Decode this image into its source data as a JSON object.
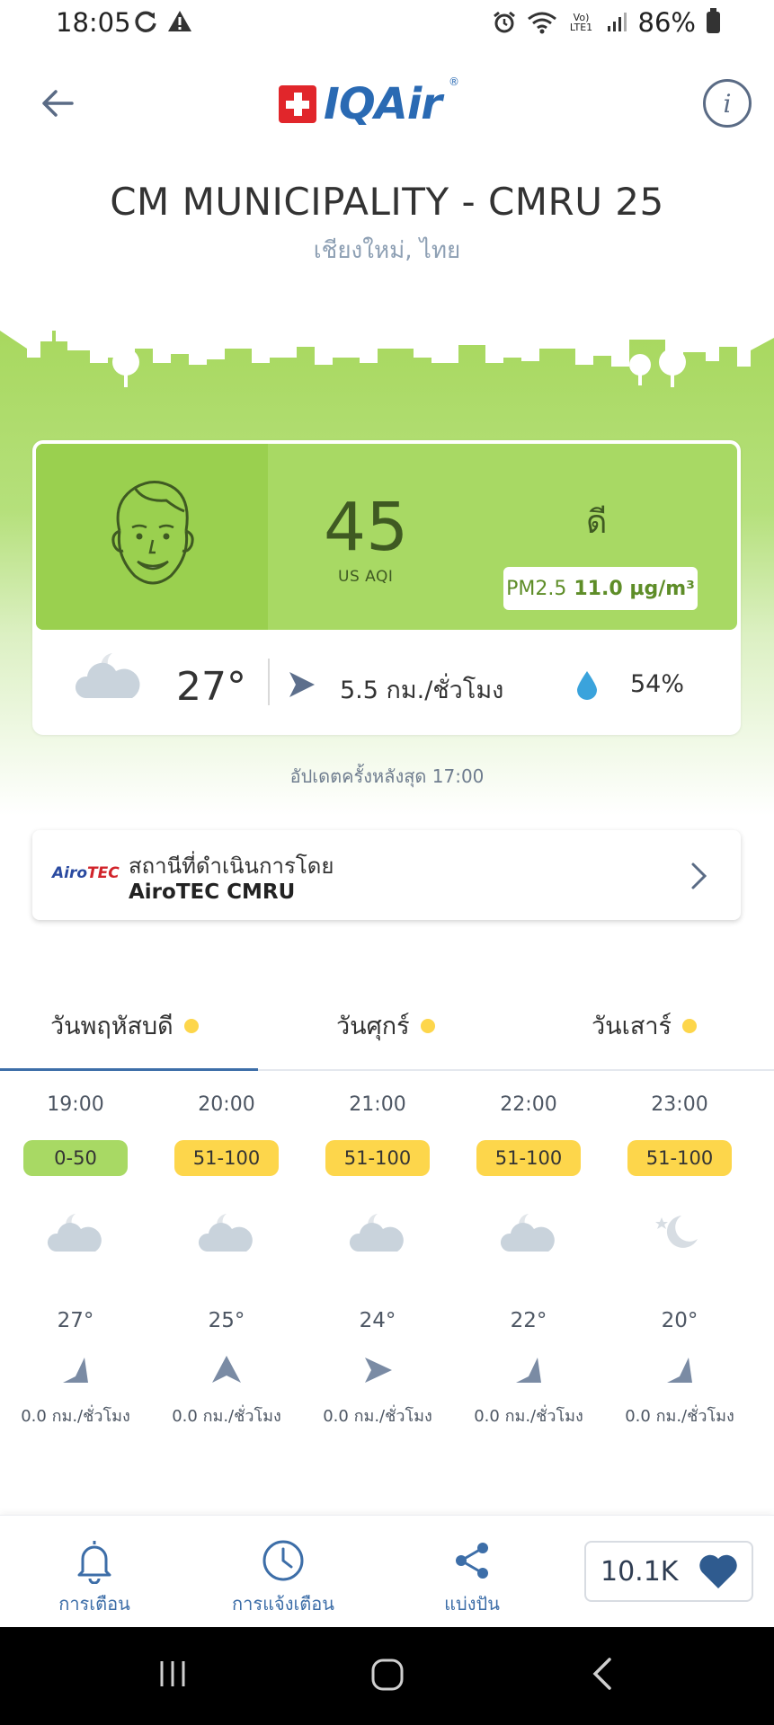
{
  "status_bar": {
    "time": "18:05",
    "battery": "86%",
    "network_label": "Vo) LTE1"
  },
  "header": {
    "logo_text": "IQAir",
    "logo_mark": "®"
  },
  "station": {
    "title": "CM MUNICIPALITY - CMRU 25",
    "location": "เชียงใหม่, ไทย"
  },
  "aqi": {
    "value": "45",
    "unit": "US AQI",
    "level": "ดี",
    "pollutant": "PM2.5",
    "pollutant_value": "11.0 µg/m³",
    "colors": {
      "good": "#a8d964",
      "good_dark": "#9ad04f",
      "moderate": "#fdd64b"
    }
  },
  "weather": {
    "temperature": "27°",
    "wind": "5.5 กม./ชั่วโมง",
    "humidity": "54%"
  },
  "updated": "อัปเดตครั้งหลังสุด 17:00",
  "operator": {
    "label": "สถานีที่ดำเนินการโดย",
    "name": "AiroTEC CMRU",
    "logo_a": "Airo",
    "logo_b": "TEC"
  },
  "tabs": [
    {
      "label": "วันพฤหัสบดี",
      "active": true
    },
    {
      "label": "วันศุกร์",
      "active": false
    },
    {
      "label": "วันเสาร์",
      "active": false
    }
  ],
  "hourly": [
    {
      "time": "19:00",
      "aqi_range": "0-50",
      "aqi_color": "#a8d964",
      "icon": "partly-cloudy-night-icon",
      "temp": "27°",
      "wind": "0.0 กม./ชั่วโมง"
    },
    {
      "time": "20:00",
      "aqi_range": "51-100",
      "aqi_color": "#fdd64b",
      "icon": "partly-cloudy-night-icon",
      "temp": "25°",
      "wind": "0.0 กม./ชั่วโมง"
    },
    {
      "time": "21:00",
      "aqi_range": "51-100",
      "aqi_color": "#fdd64b",
      "icon": "partly-cloudy-night-icon",
      "temp": "24°",
      "wind": "0.0 กม./ชั่วโมง"
    },
    {
      "time": "22:00",
      "aqi_range": "51-100",
      "aqi_color": "#fdd64b",
      "icon": "partly-cloudy-night-icon",
      "temp": "22°",
      "wind": "0.0 กม./ชั่วโมง"
    },
    {
      "time": "23:00",
      "aqi_range": "51-100",
      "aqi_color": "#fdd64b",
      "icon": "clear-night-icon",
      "temp": "20°",
      "wind": "0.0 กม./ชั่วโมง"
    }
  ],
  "bottom_bar": {
    "alerts": "การเตือน",
    "notifications": "การแจ้งเตือน",
    "share": "แบ่งปัน",
    "likes": "10.1K"
  }
}
